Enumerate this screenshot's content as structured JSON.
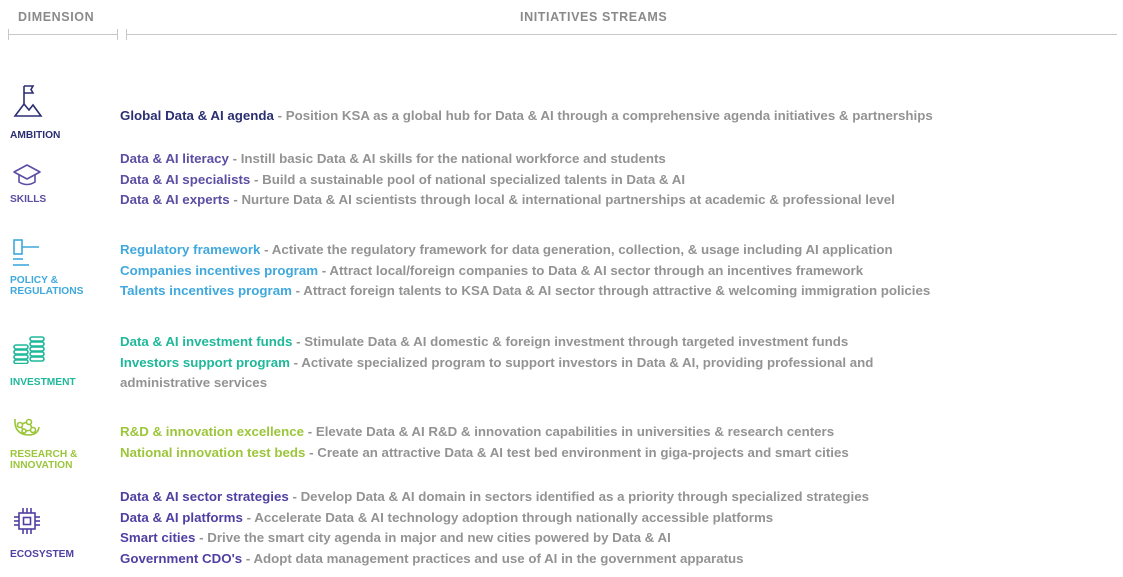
{
  "header": {
    "dimension": "DIMENSION",
    "streams": "INITIATIVES STREAMS"
  },
  "colors": {
    "ambition": "#2b2f72",
    "skills": "#5b4ea3",
    "policy": "#3fa8dc",
    "investment": "#1fb89a",
    "research": "#9cc63a",
    "ecosystem": "#5040a2"
  },
  "rows": [
    {
      "label": "AMBITION",
      "icon": "flag-mountain-icon",
      "lines": [
        {
          "title": "Global Data & AI agenda",
          "desc": "- Position KSA as a global hub for Data & AI through a comprehensive agenda initiatives & partnerships"
        }
      ]
    },
    {
      "label": "SKILLS",
      "icon": "graduation-cap-icon",
      "lines": [
        {
          "title": "Data & AI literacy",
          "desc": "- Instill basic Data & AI skills for the national workforce and students"
        },
        {
          "title": "Data & AI specialists",
          "desc": "- Build a sustainable pool of national specialized talents in Data & AI"
        },
        {
          "title": "Data & AI experts",
          "desc": "- Nurture Data & AI scientists through local & international partnerships at academic & professional level"
        }
      ]
    },
    {
      "label": "POLICY & REGULATIONS",
      "icon": "gavel-icon",
      "lines": [
        {
          "title": "Regulatory framework",
          "desc": "- Activate the regulatory framework for data generation, collection, & usage including AI application"
        },
        {
          "title": "Companies incentives program",
          "desc": "- Attract local/foreign companies to Data & AI sector through an incentives framework"
        },
        {
          "title": "Talents incentives program",
          "desc": "- Attract foreign talents to KSA Data & AI sector through attractive & welcoming immigration policies"
        }
      ]
    },
    {
      "label": "INVESTMENT",
      "icon": "coin-stack-icon",
      "lines": [
        {
          "title": "Data & AI investment funds",
          "desc": "- Stimulate Data & AI domestic & foreign investment through targeted investment funds"
        },
        {
          "title": "Investors support program",
          "desc": "- Activate specialized program to support investors in Data & AI, providing professional and administrative services"
        }
      ]
    },
    {
      "label": "RESEARCH & INNOVATION",
      "icon": "research-network-icon",
      "lines": [
        {
          "title": "R&D & innovation excellence",
          "desc": "- Elevate Data & AI R&D & innovation capabilities in universities & research centers"
        },
        {
          "title": "National innovation test beds",
          "desc": "- Create an attractive Data & AI test bed environment in giga-projects and smart cities"
        }
      ]
    },
    {
      "label": "ECOSYSTEM",
      "icon": "chip-icon",
      "lines": [
        {
          "title": "Data & AI sector strategies",
          "desc": "- Develop Data & AI domain in sectors identified as a priority through specialized strategies"
        },
        {
          "title": "Data & AI platforms",
          "desc": "- Accelerate Data & AI technology adoption through nationally accessible platforms"
        },
        {
          "title": "Smart cities",
          "desc": "- Drive the smart city agenda in major and new cities powered by Data & AI"
        },
        {
          "title": "Government CDO's",
          "desc": "- Adopt data management practices and use of AI in the government apparatus"
        }
      ]
    }
  ]
}
